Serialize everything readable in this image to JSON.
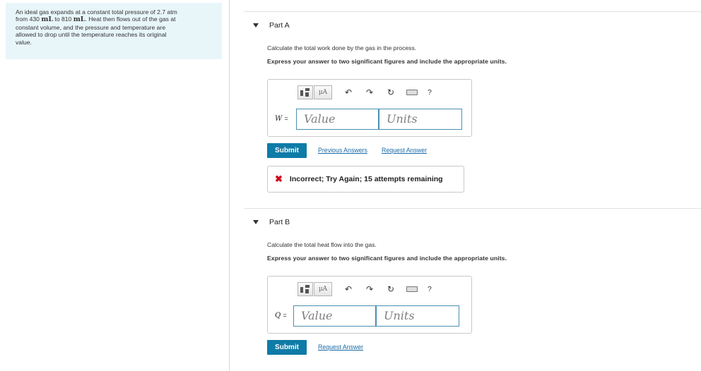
{
  "problem": {
    "line1": "An ideal gas expands at a constant total pressure of 2.7 atm",
    "line2_pre": "from 430 ",
    "unit_ml": "mL",
    "line2_mid": " to 810 ",
    "line2_post": ". Heat then flows out of the gas at",
    "line3": "constant volume, and the pressure and temperature are",
    "line4": "allowed to drop until the temperature reaches its original",
    "line5": "value."
  },
  "partA": {
    "title": "Part A",
    "question": "Calculate the total work done by the gas in the process.",
    "instruction": "Express your answer to two significant figures and include the appropriate units.",
    "toolbar": {
      "mu_label": "μA",
      "help": "?"
    },
    "variable": "W",
    "equals": "=",
    "value_placeholder": "Value",
    "units_placeholder": "Units",
    "submit_label": "Submit",
    "previous_answers": "Previous Answers",
    "request_answer": "Request Answer",
    "feedback": "Incorrect; Try Again; 15 attempts remaining"
  },
  "partB": {
    "title": "Part B",
    "question": "Calculate the total heat flow into the gas.",
    "instruction": "Express your answer to two significant figures and include the appropriate units.",
    "toolbar": {
      "mu_label": "μA",
      "help": "?"
    },
    "variable": "Q",
    "equals": "=",
    "value_placeholder": "Value",
    "units_placeholder": "Units",
    "submit_label": "Submit",
    "request_answer": "Request Answer"
  },
  "colors": {
    "accent": "#0f7ba7",
    "link": "#1a6aa6",
    "error": "#d0021b",
    "problem_bg": "#e8f6f9"
  },
  "icons": [
    "template-icon",
    "undo-icon",
    "redo-icon",
    "reset-icon",
    "keyboard-icon",
    "help-icon",
    "caret-down-icon",
    "x-icon"
  ]
}
